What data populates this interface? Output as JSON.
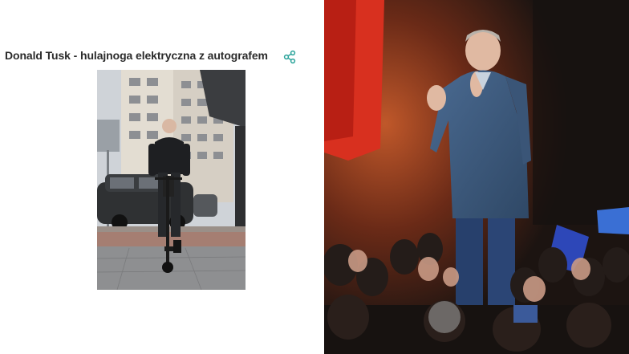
{
  "article": {
    "title": "Donald Tusk - hulajnoga elektryczna z autografem"
  },
  "icons": {
    "share": "share-icon"
  },
  "colors": {
    "share_icon": "#2aa39a",
    "title_text": "#2b2b2b",
    "coat": "#3d5a7e"
  }
}
